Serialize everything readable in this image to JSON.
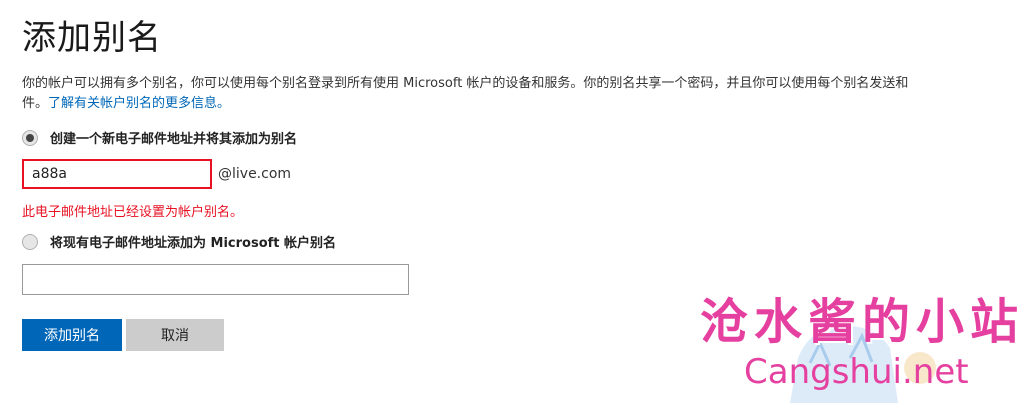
{
  "page": {
    "title": "添加别名",
    "description_line1": "你的帐户可以拥有多个别名，你可以使用每个别名登录到所有使用 Microsoft 帐户的设备和服务。你的别名共享一个密码，并且你可以使用每个别名发送和",
    "description_line2_prefix": "件。",
    "learn_more_link": "了解有关帐户别名的更多信息。"
  },
  "option_new": {
    "label": "创建一个新电子邮件地址并将其添加为别名",
    "selected": true,
    "input_value": "a88a",
    "domain_suffix": "@live.com",
    "error_text": "此电子邮件地址已经设置为帐户别名。"
  },
  "option_existing": {
    "label": "将现有电子邮件地址添加为 Microsoft 帐户别名",
    "selected": false,
    "input_value": ""
  },
  "buttons": {
    "add_label": "添加别名",
    "cancel_label": "取消"
  },
  "watermark": {
    "text_cn": "沧水酱的小站",
    "text_en": "Cangshui.net"
  },
  "colors": {
    "accent": "#0067b8",
    "error": "#e81123",
    "watermark": "#e5409f"
  }
}
